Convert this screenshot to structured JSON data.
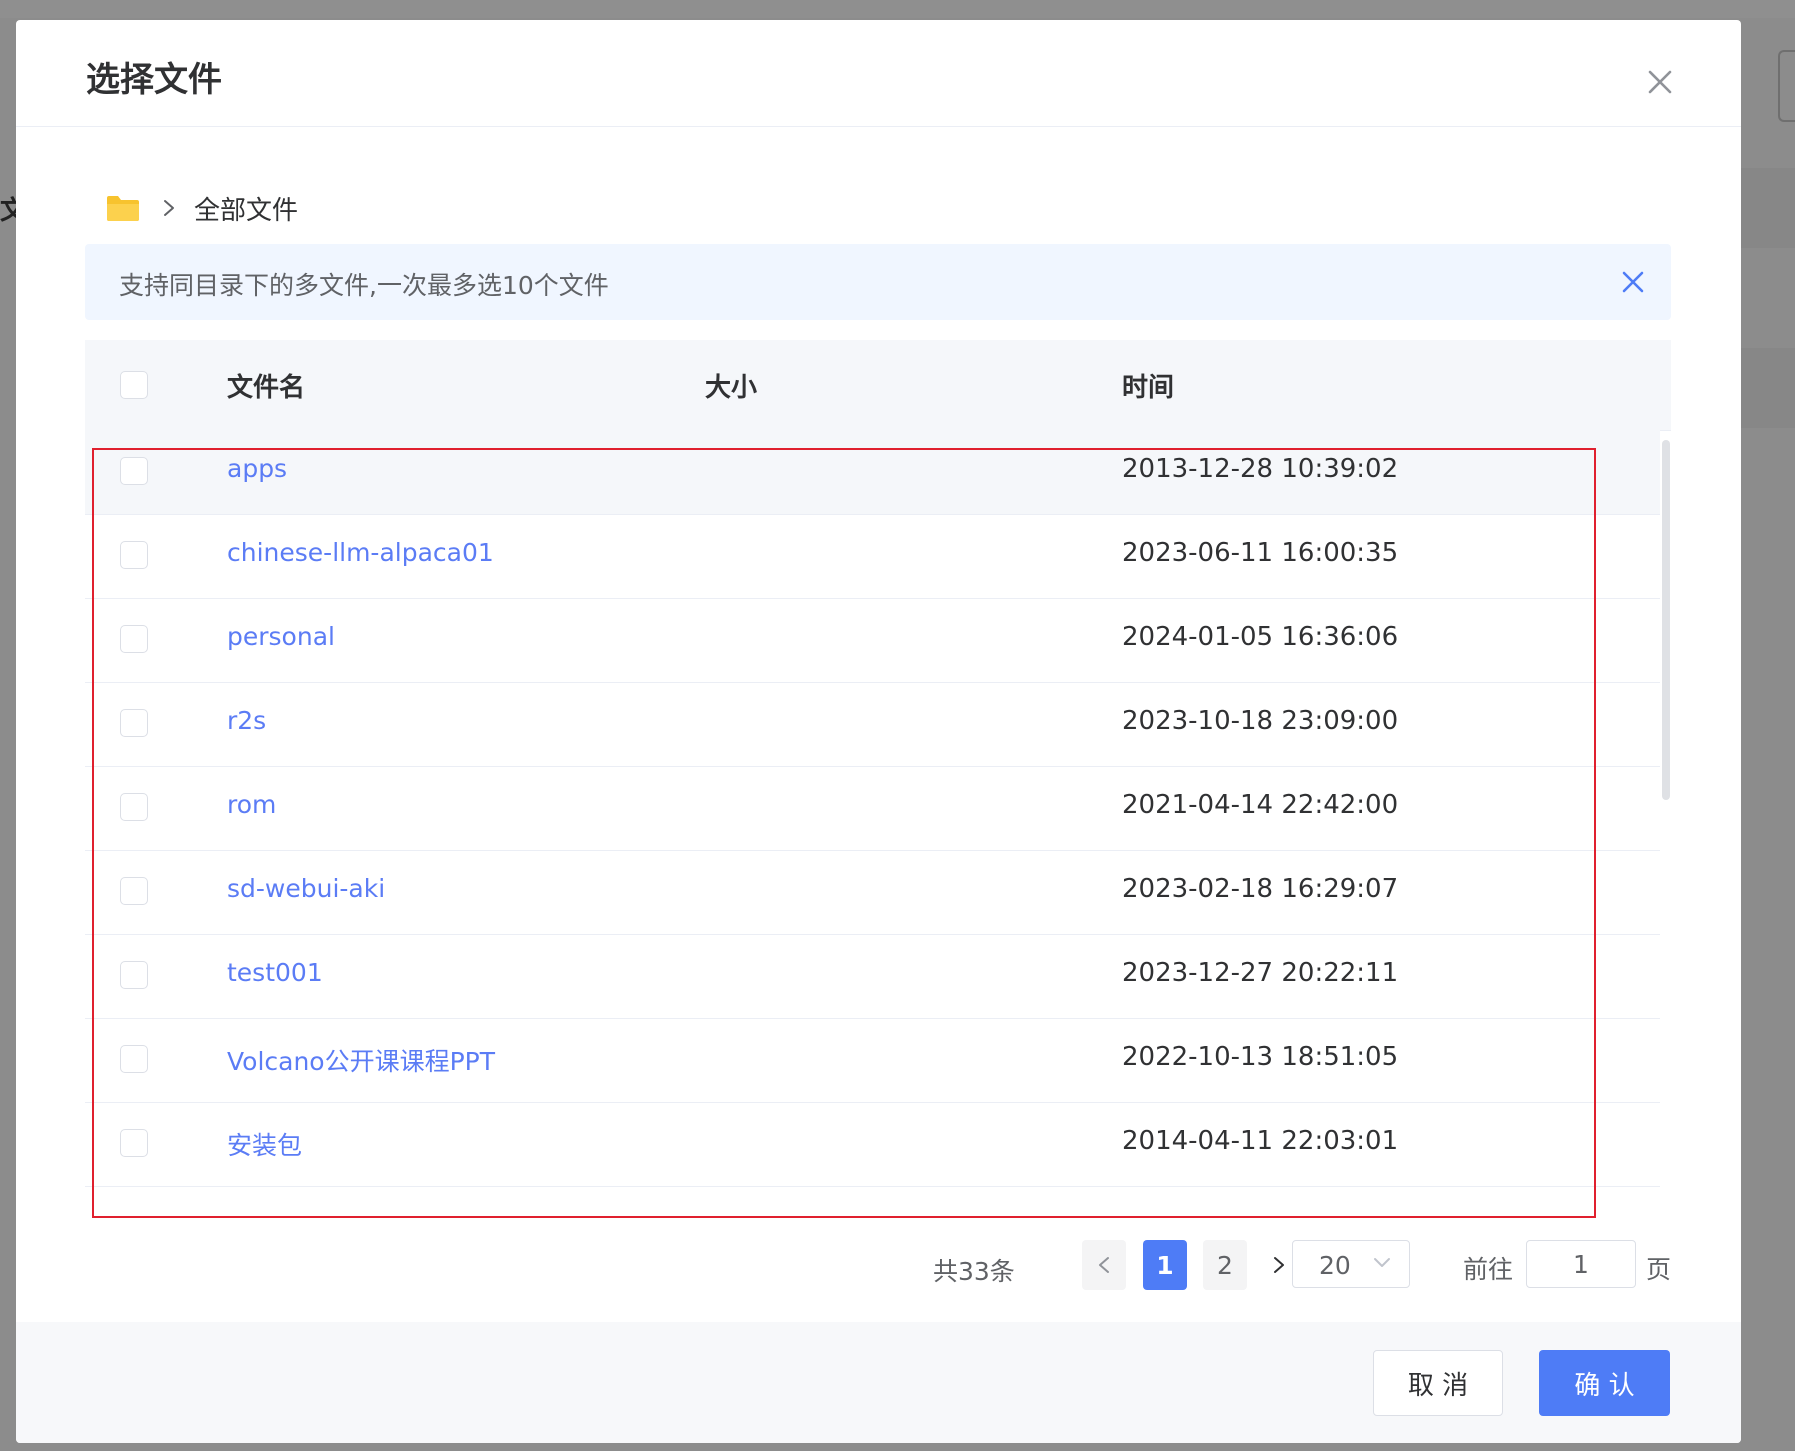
{
  "dialog": {
    "title": "选择文件",
    "close_icon": "close-icon"
  },
  "breadcrumb": {
    "root_icon": "folder-icon",
    "separator_icon": "chevron-right-icon",
    "current": "全部文件"
  },
  "alert": {
    "text": "支持同目录下的多文件,一次最多选10个文件",
    "close_icon": "close-icon"
  },
  "table": {
    "columns": [
      "文件名",
      "大小",
      "时间"
    ],
    "rows": [
      {
        "name": "apps",
        "size": "",
        "time": "2013-12-28 10:39:02"
      },
      {
        "name": "chinese-llm-alpaca01",
        "size": "",
        "time": "2023-06-11 16:00:35"
      },
      {
        "name": "personal",
        "size": "",
        "time": "2024-01-05 16:36:06"
      },
      {
        "name": "r2s",
        "size": "",
        "time": "2023-10-18 23:09:00"
      },
      {
        "name": "rom",
        "size": "",
        "time": "2021-04-14 22:42:00"
      },
      {
        "name": "sd-webui-aki",
        "size": "",
        "time": "2023-02-18 16:29:07"
      },
      {
        "name": "test001",
        "size": "",
        "time": "2023-12-27 20:22:11"
      },
      {
        "name": "Volcano公开课课程PPT",
        "size": "",
        "time": "2022-10-13 18:51:05"
      },
      {
        "name": "安装包",
        "size": "",
        "time": "2014-04-11 22:03:01"
      }
    ]
  },
  "pagination": {
    "total": "共33条",
    "prev_icon": "chevron-left-icon",
    "pages": [
      "1",
      "2"
    ],
    "current_page": "1",
    "next_icon": "chevron-right-icon",
    "page_size": "20",
    "goto_label": "前往",
    "goto_value": "1",
    "page_suffix": "页"
  },
  "footer": {
    "cancel_label": "取 消",
    "confirm_label": "确 认"
  },
  "colors": {
    "primary": "#4e7cf6",
    "link": "#5b7cf5",
    "alert_bg": "#f0f6ff",
    "highlight_border": "#e0202e",
    "folder": "#f7c32e"
  }
}
